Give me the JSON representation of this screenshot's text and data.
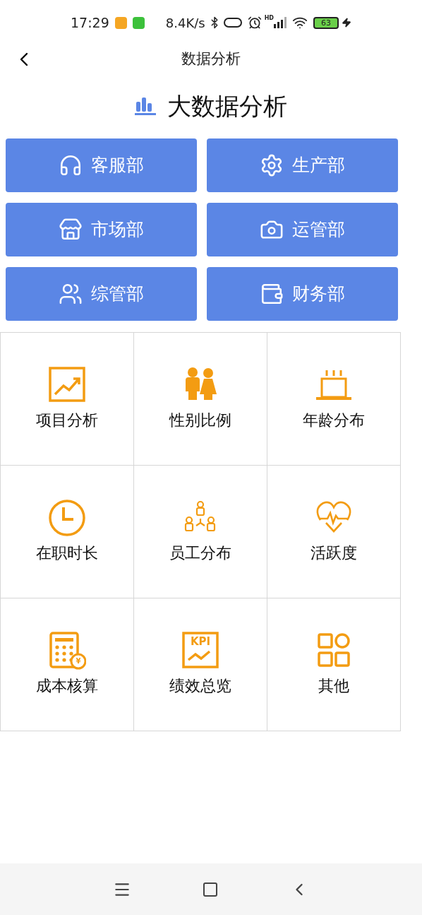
{
  "status_bar": {
    "time": "17:29",
    "speed": "8.4K/s",
    "signal_label": "HD",
    "battery": "63"
  },
  "header": {
    "title": "数据分析"
  },
  "section": {
    "title": "大数据分析"
  },
  "departments": [
    {
      "label": "客服部",
      "kind": "headphones"
    },
    {
      "label": "生产部",
      "kind": "settings"
    },
    {
      "label": "市场部",
      "kind": "store"
    },
    {
      "label": "运管部",
      "kind": "camera"
    },
    {
      "label": "综管部",
      "kind": "users"
    },
    {
      "label": "财务部",
      "kind": "wallet"
    }
  ],
  "tiles": [
    {
      "label": "项目分析",
      "kind": "trend"
    },
    {
      "label": "性别比例",
      "kind": "gender"
    },
    {
      "label": "年龄分布",
      "kind": "cake"
    },
    {
      "label": "在职时长",
      "kind": "clock"
    },
    {
      "label": "员工分布",
      "kind": "org"
    },
    {
      "label": "活跃度",
      "kind": "heart"
    },
    {
      "label": "成本核算",
      "kind": "calculator",
      "icon_text": "¥"
    },
    {
      "label": "绩效总览",
      "kind": "kpi",
      "icon_text": "KPI"
    },
    {
      "label": "其他",
      "kind": "apps"
    }
  ]
}
